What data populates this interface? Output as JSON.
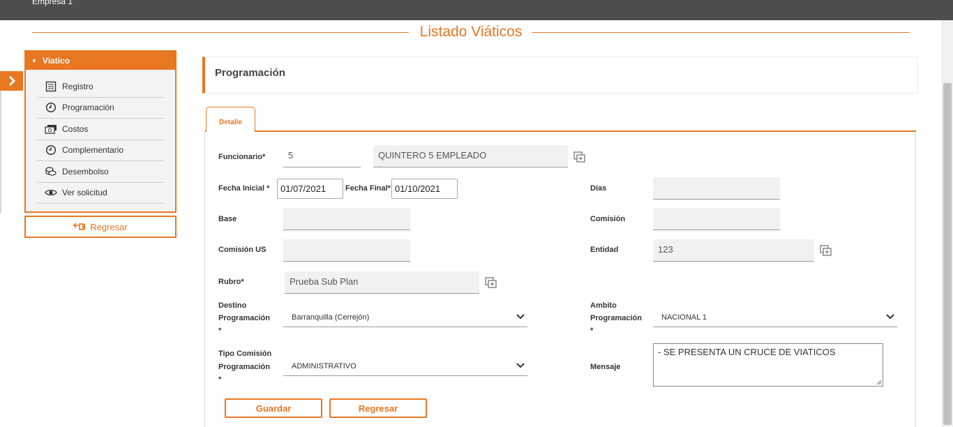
{
  "header": {
    "company": "Empresa 1"
  },
  "page": {
    "title": "Listado Viáticos"
  },
  "sidebar": {
    "section_label": "Viatico",
    "items": [
      {
        "label": "Registro",
        "icon": "list-icon"
      },
      {
        "label": "Programación",
        "icon": "clock-icon"
      },
      {
        "label": "Costos",
        "icon": "money-icon"
      },
      {
        "label": "Complementario",
        "icon": "clock-icon"
      },
      {
        "label": "Desembolso",
        "icon": "coins-icon"
      },
      {
        "label": "Ver solicitud",
        "icon": "eye-icon"
      }
    ],
    "back_label": "Regresar"
  },
  "section": {
    "title": "Programación"
  },
  "tabs": [
    {
      "label": "Detalle",
      "active": true
    }
  ],
  "form": {
    "funcionario": {
      "label": "Funcionario*",
      "code": "5",
      "name": "QUINTERO 5 EMPLEADO"
    },
    "fecha_inicial": {
      "label": "Fecha Inicial *",
      "value": "01/07/2021"
    },
    "fecha_final": {
      "label": "Fecha Final*",
      "value": "01/10/2021"
    },
    "dias": {
      "label": "Días",
      "value": ""
    },
    "base": {
      "label": "Base",
      "value": ""
    },
    "comision": {
      "label": "Comisión",
      "value": ""
    },
    "comision_us": {
      "label": "Comisión US",
      "value": ""
    },
    "entidad": {
      "label": "Entidad",
      "value": "123"
    },
    "rubro": {
      "label": "Rubro*",
      "value": "Prueba Sub Plan"
    },
    "destino": {
      "label_line1": "Destino",
      "label_line2": "Programación",
      "label_line3": "*",
      "value": "Barranquilla (Cerrejón)"
    },
    "ambito": {
      "label_line1": "Ambito",
      "label_line2": "Programación",
      "label_line3": "*",
      "value": "NACIONAL 1"
    },
    "tipo_comision": {
      "label_line1": "Tipo Comisión",
      "label_line2": "Programación",
      "label_line3": "*",
      "value": "ADMINISTRATIVO"
    },
    "mensaje": {
      "label": "Mensaje",
      "value": "- SE PRESENTA UN CRUCE DE VIATICOS"
    }
  },
  "buttons": {
    "save": "Guardar",
    "back": "Regresar"
  },
  "colors": {
    "accent": "#e87722",
    "topbar": "#4d4d4d"
  }
}
